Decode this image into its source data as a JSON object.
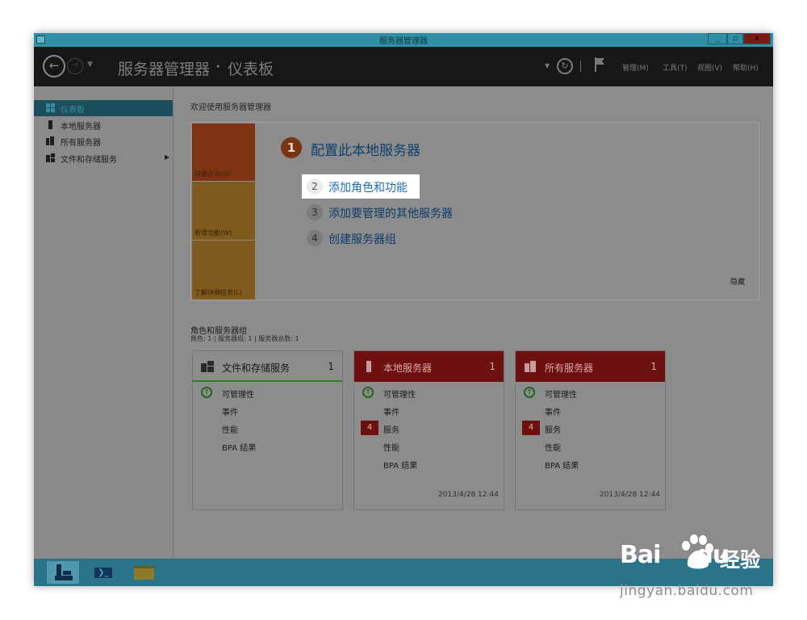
{
  "window": {
    "title": "服务器管理器",
    "controls": {
      "minimize": "_",
      "maximize": "▫",
      "close": "x"
    }
  },
  "header": {
    "breadcrumb_app": "服务器管理器",
    "breadcrumb_sep": "•",
    "breadcrumb_page": "仪表板",
    "menu": [
      "管理(M)",
      "工具(T)",
      "视图(V)",
      "帮助(H)"
    ]
  },
  "sidebar": {
    "items": [
      {
        "label": "仪表板",
        "icon": "dashboard-icon",
        "active": true
      },
      {
        "label": "本地服务器",
        "icon": "server-icon",
        "active": false
      },
      {
        "label": "所有服务器",
        "icon": "servers-icon",
        "active": false
      },
      {
        "label": "文件和存储服务",
        "icon": "storage-icon",
        "active": false,
        "expandable": true
      }
    ],
    "expand_glyph": "▶"
  },
  "welcome": {
    "label": "欢迎使用服务器管理器",
    "tiles": [
      "快速启动(Q)",
      "新增功能(W)",
      "了解详细信息(L)"
    ],
    "step1": {
      "num": "1",
      "text": "配置此本地服务器"
    },
    "steps": [
      {
        "num": "2",
        "text": "添加角色和功能",
        "highlight": true
      },
      {
        "num": "3",
        "text": "添加要管理的其他服务器",
        "highlight": false
      },
      {
        "num": "4",
        "text": "创建服务器组",
        "highlight": false
      }
    ],
    "hide": "隐藏"
  },
  "roles": {
    "title": "角色和服务器组",
    "subtitle": "角色: 1 | 服务器组: 1 | 服务器总数: 1",
    "cards": [
      {
        "title": "文件和存储服务",
        "count": "1",
        "style": "plain",
        "rows": [
          "可管理性",
          "事件",
          "性能",
          "BPA 结果"
        ],
        "timestamp": ""
      },
      {
        "title": "本地服务器",
        "count": "1",
        "style": "red",
        "rows": [
          "可管理性",
          "事件",
          "服务",
          "性能",
          "BPA 结果"
        ],
        "badge": "4",
        "timestamp": "2013/4/28 12:44"
      },
      {
        "title": "所有服务器",
        "count": "1",
        "style": "red",
        "rows": [
          "可管理性",
          "事件",
          "服务",
          "性能",
          "BPA 结果"
        ],
        "badge": "4",
        "timestamp": "2013/4/28 12:44"
      }
    ]
  },
  "taskbar": {
    "items": [
      "server-manager-icon",
      "powershell-icon",
      "file-explorer-icon"
    ],
    "ps_glyph": "❯_"
  },
  "watermark": {
    "brand": "Bai",
    "brand2": "du",
    "product": "经验",
    "url": "jingyan.baidu.com"
  },
  "colors": {
    "accent": "#2f8fa4",
    "alert_red": "#6e1010",
    "tile_orange": "#7e3412",
    "tile_gold": "#7e5a1c",
    "link_blue": "#1f6fb8"
  }
}
